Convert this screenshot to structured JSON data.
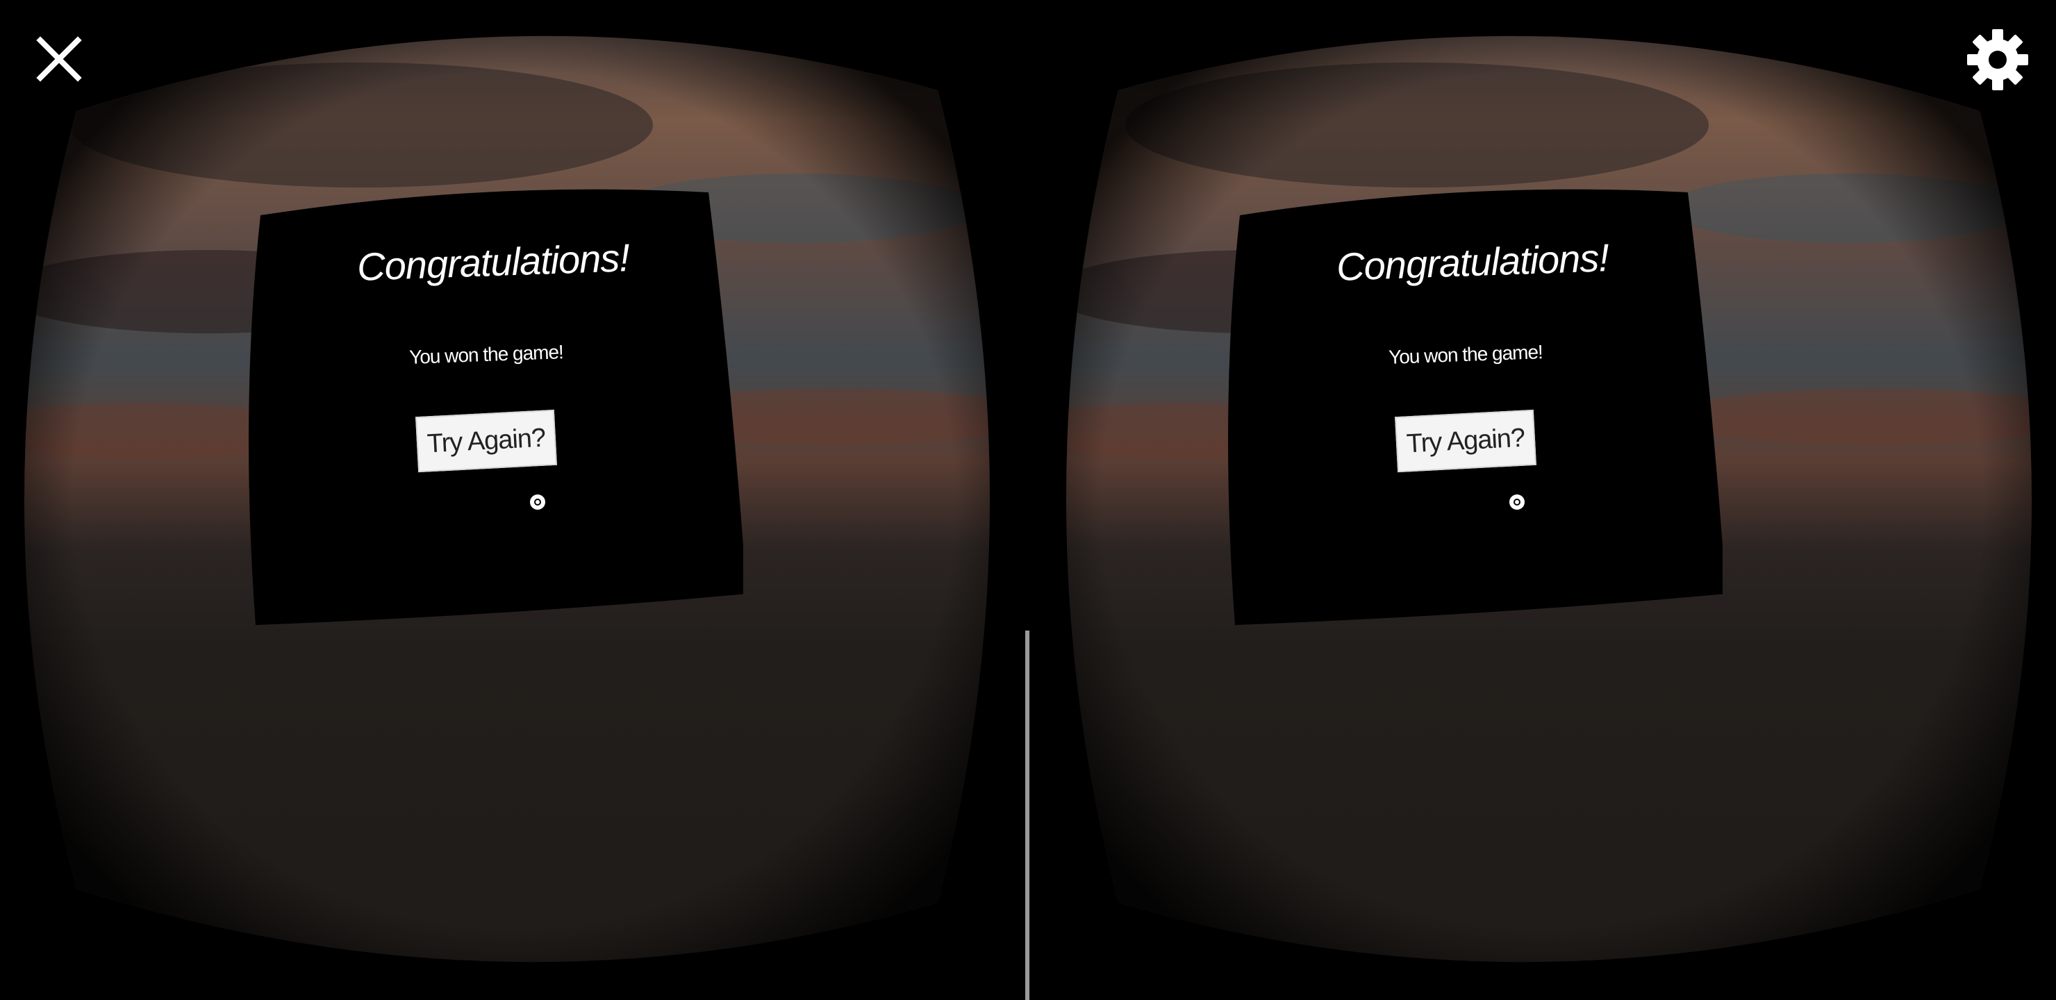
{
  "toolbar": {
    "close_icon": "close-icon",
    "settings_icon": "gear-icon"
  },
  "dialog": {
    "title": "Congratulations!",
    "message": "You won the game!",
    "button_label": "Try Again?"
  },
  "colors": {
    "background": "#000000",
    "panel": "#000000",
    "text": "#ffffff",
    "button_bg": "#f4f4f4",
    "button_text": "#222222",
    "divider": "#9a9a9a"
  }
}
